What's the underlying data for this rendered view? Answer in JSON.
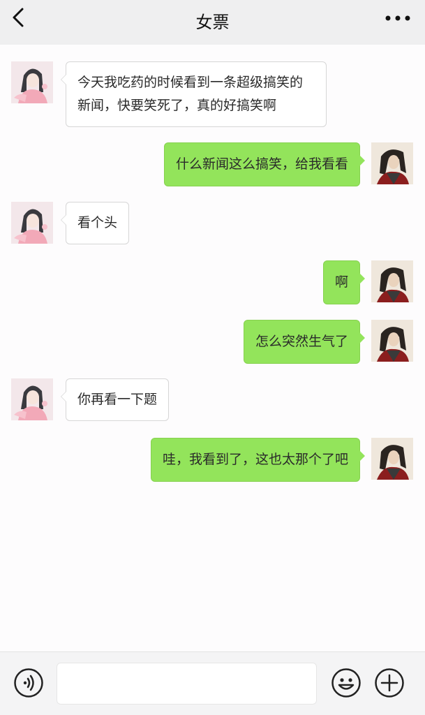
{
  "header": {
    "title": "女票",
    "back_icon": "chevron-left-icon",
    "more_icon": "more-dots-icon"
  },
  "messages": [
    {
      "sender": "them",
      "text": "今天我吃药的时候看到一条超级搞笑的新闻，快要笑死了，真的好搞笑啊"
    },
    {
      "sender": "me",
      "text": "什么新闻这么搞笑，给我看看"
    },
    {
      "sender": "them",
      "text": "看个头"
    },
    {
      "sender": "me",
      "text": "啊"
    },
    {
      "sender": "me",
      "text": "怎么突然生气了"
    },
    {
      "sender": "them",
      "text": "你再看一下题"
    },
    {
      "sender": "me",
      "text": "哇，我看到了，这也太那个了吧"
    }
  ],
  "footer": {
    "input_value": "",
    "voice_icon": "voice-icon",
    "emoji_icon": "emoji-icon",
    "plus_icon": "plus-icon"
  },
  "colors": {
    "outgoing_bubble": "#93e45b",
    "incoming_bubble": "#ffffff",
    "header_bg": "#efeff0",
    "page_bg": "#fdfcfd"
  }
}
